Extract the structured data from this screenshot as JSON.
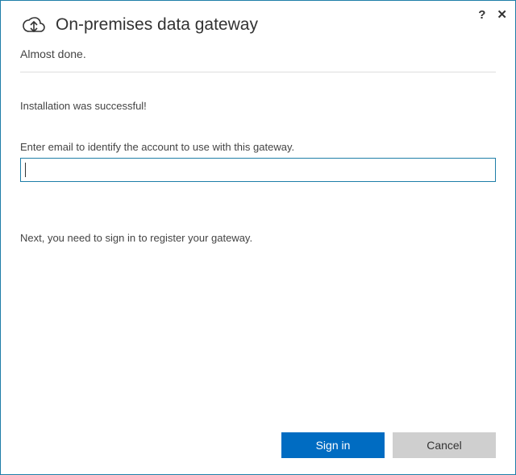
{
  "header": {
    "title": "On-premises data gateway"
  },
  "subtitle": "Almost done.",
  "status": "Installation was successful!",
  "email": {
    "label": "Enter email to identify the account to use with this gateway.",
    "value": ""
  },
  "nextText": "Next, you need to sign in to register your gateway.",
  "buttons": {
    "signIn": "Sign in",
    "cancel": "Cancel"
  },
  "titlebar": {
    "help": "?",
    "close": "✕"
  }
}
